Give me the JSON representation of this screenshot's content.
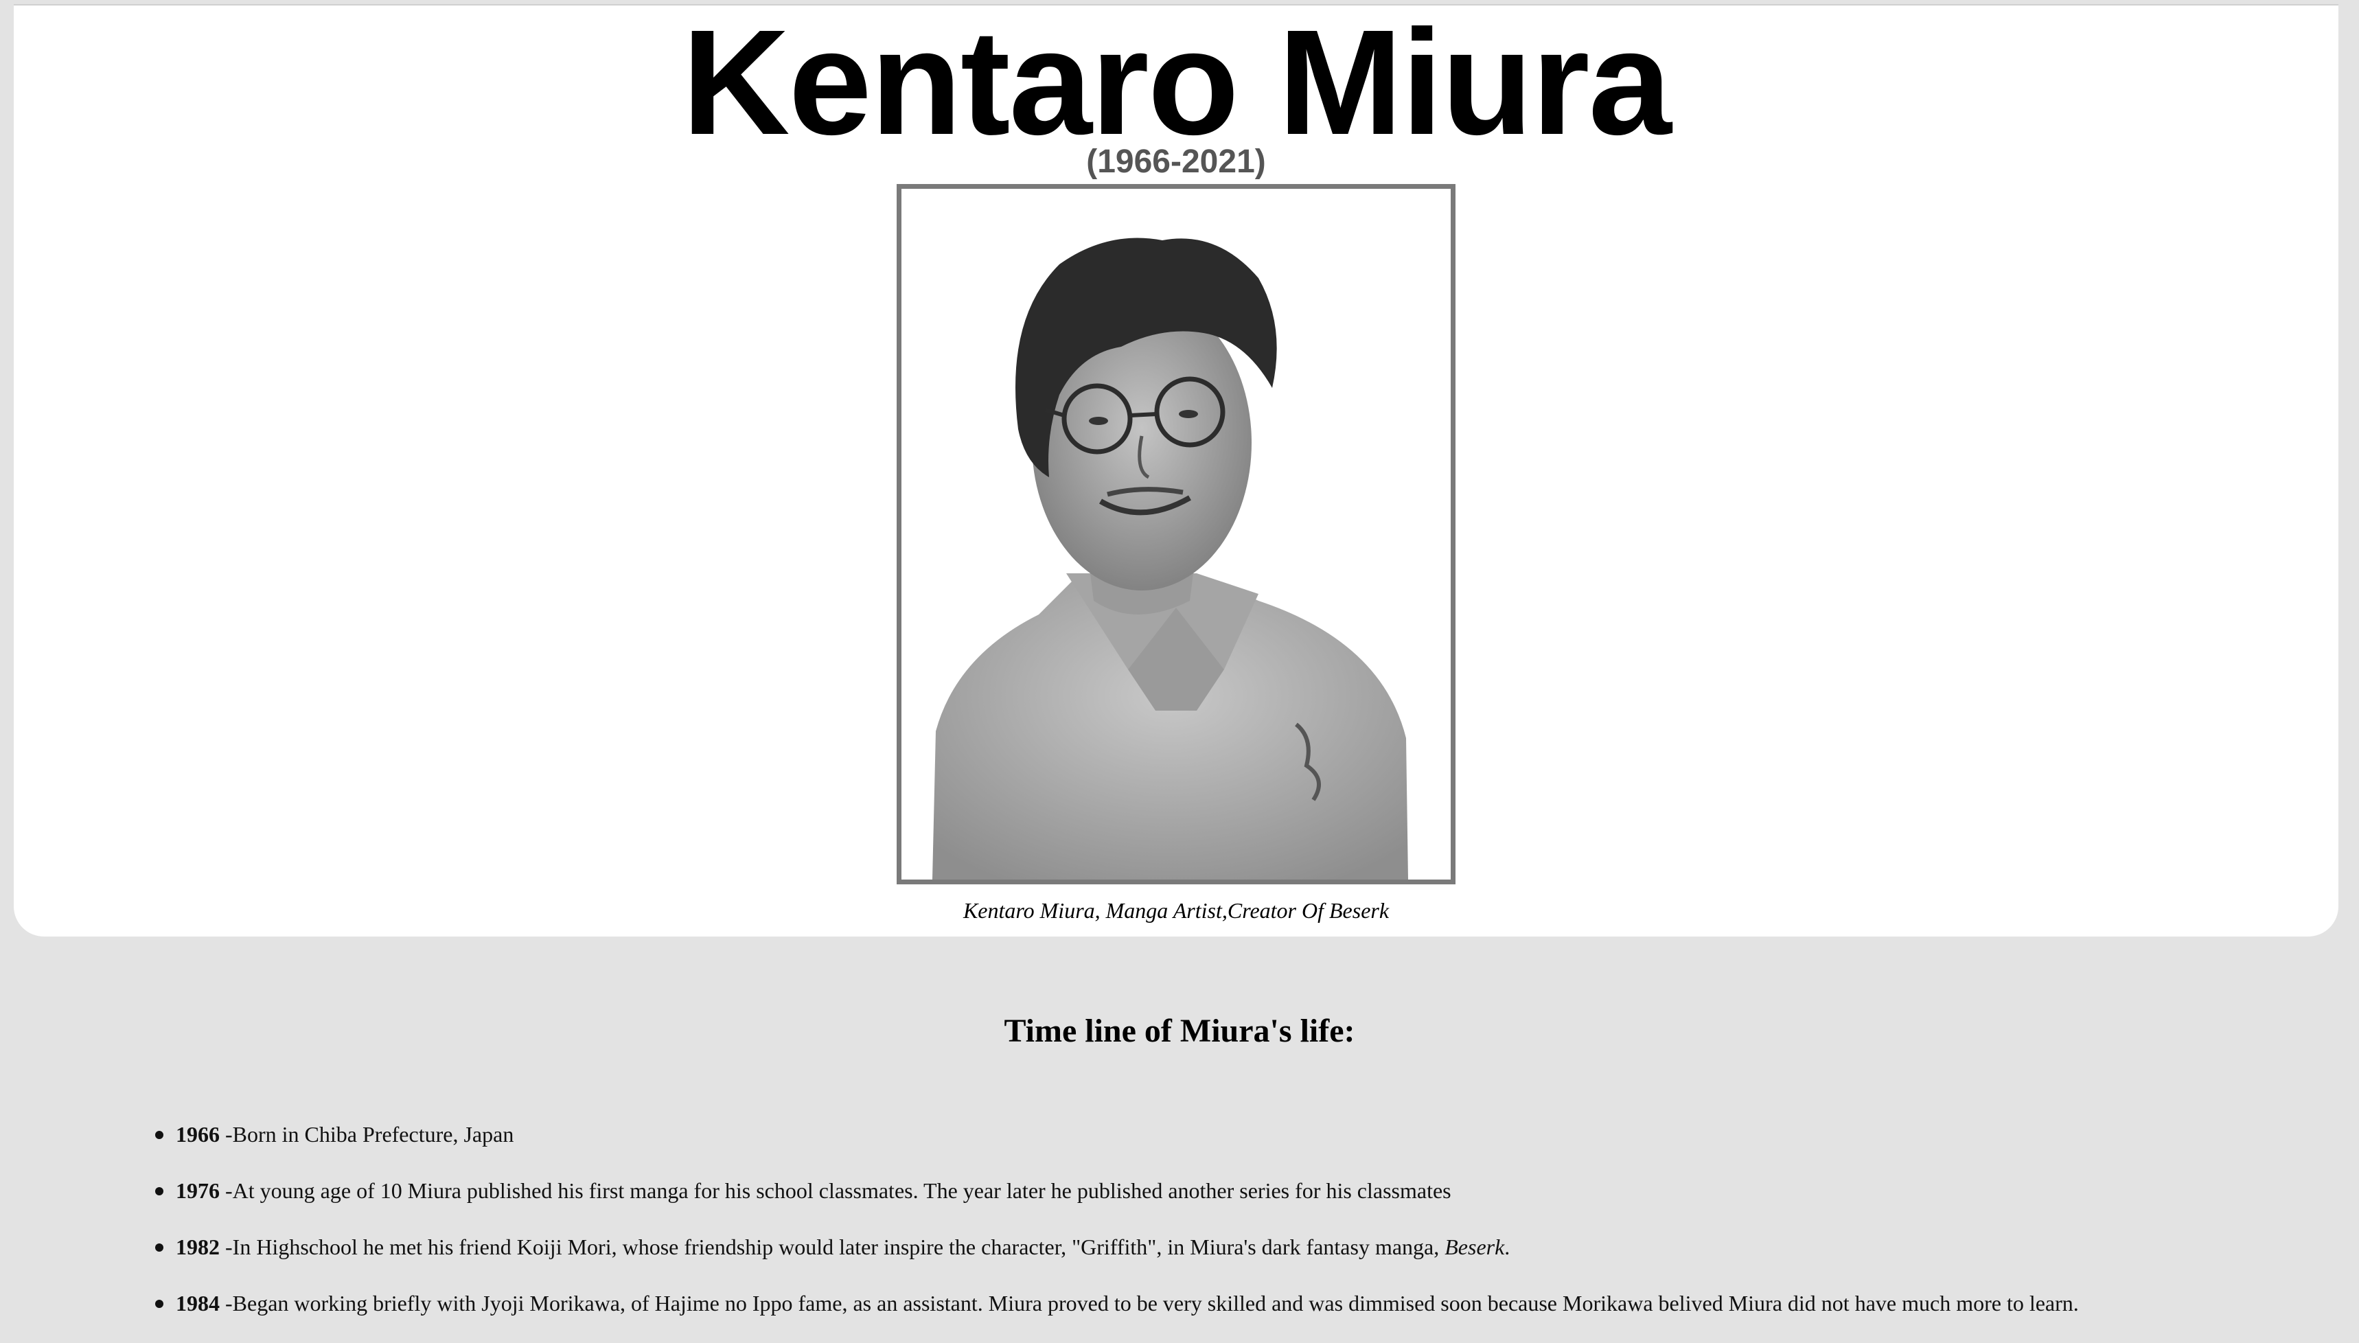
{
  "header": {
    "title": "Kentaro Miura",
    "dates": "(1966-2021)"
  },
  "portrait": {
    "icon": "portrait-photo",
    "caption": "Kentaro Miura, Manga Artist,Creator Of Beserk"
  },
  "timeline": {
    "heading": "Time line of Miura's life:",
    "items": [
      {
        "year": "1966",
        "text": " -Born in Chiba Prefecture, Japan",
        "emphasis": "",
        "after": ""
      },
      {
        "year": "1976",
        "text": " -At young age of 10 Miura published his first manga for his school classmates. The year later he published another series for his classmates",
        "emphasis": "",
        "after": ""
      },
      {
        "year": "1982",
        "text": " -In Highschool he met his friend Koiji Mori, whose friendship would later inspire the character, \"Griffith\", in Miura's dark fantasy manga, ",
        "emphasis": "Beserk",
        "after": "."
      },
      {
        "year": "1984",
        "text": " -Began working briefly with Jyoji Morikawa, of Hajime no Ippo fame, as an assistant. Miura proved to be very skilled and was dimmised soon because Morikawa belived Miura did not have much more to learn.",
        "emphasis": "",
        "after": ""
      }
    ]
  }
}
